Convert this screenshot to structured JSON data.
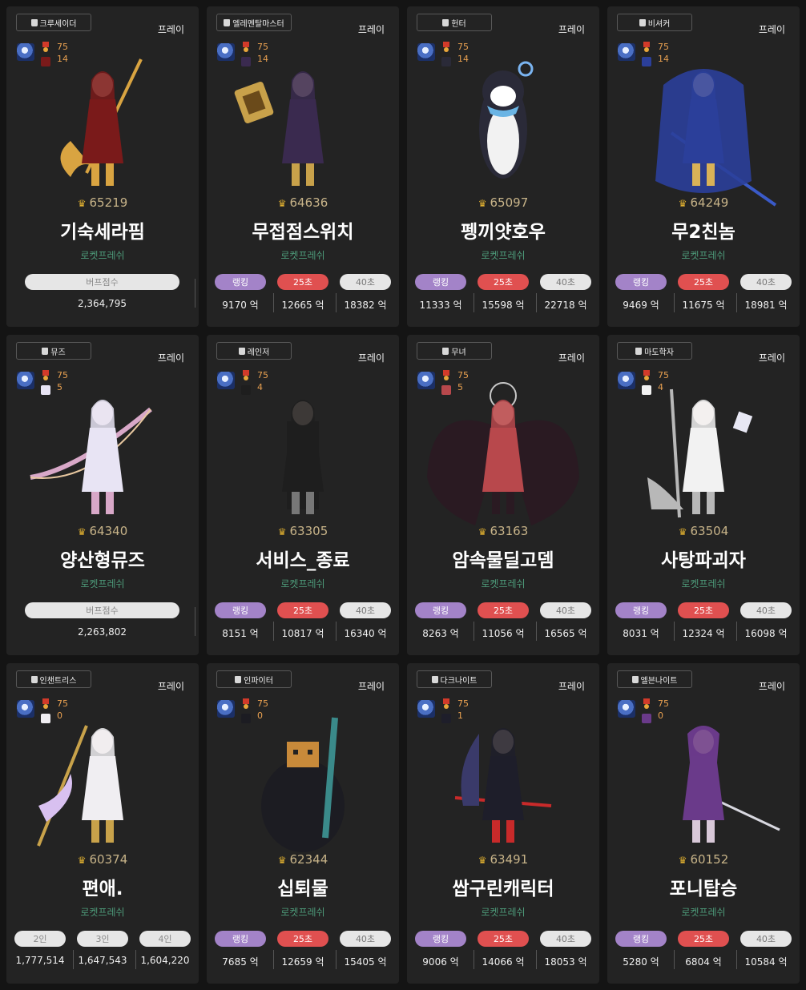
{
  "common": {
    "play_label": "프레이",
    "level": "75"
  },
  "cards": [
    {
      "job": "크루세이더",
      "count": "14",
      "score": "65219",
      "name": "기숙세라핌",
      "guild": "로켓프레쉬",
      "kind": "buff",
      "buff": {
        "label": "버프점수",
        "value": "2,364,795"
      },
      "sprite": {
        "main": "#7a1a1a",
        "accent": "#d9a441",
        "skin": "#f0d6c4",
        "prop": "spear-gold"
      }
    },
    {
      "job": "엘레멘탈마스터",
      "count": "14",
      "score": "64636",
      "name": "무접점스위치",
      "guild": "로켓프레쉬",
      "kind": "dmg",
      "stats": [
        {
          "label": "랭킹",
          "value": "9170 억"
        },
        {
          "label": "25초",
          "value": "12665 억"
        },
        {
          "label": "40초",
          "value": "18382 억"
        }
      ],
      "sprite": {
        "main": "#3a2a4f",
        "accent": "#c8a14a",
        "skin": "#f0d6c4",
        "prop": "book"
      }
    },
    {
      "job": "헌터",
      "count": "14",
      "score": "65097",
      "name": "펭끼얏호우",
      "guild": "로켓프레쉬",
      "kind": "dmg",
      "stats": [
        {
          "label": "랭킹",
          "value": "11333 억"
        },
        {
          "label": "25초",
          "value": "15598 억"
        },
        {
          "label": "40초",
          "value": "22718 억"
        }
      ],
      "sprite": {
        "main": "#2a2a38",
        "accent": "#f2f2f2",
        "skin": "#f6f6f6",
        "prop": "penguin"
      }
    },
    {
      "job": "비셔커",
      "count": "14",
      "score": "64249",
      "name": "무2친놈",
      "guild": "로켓프레쉬",
      "kind": "dmg",
      "stats": [
        {
          "label": "랭킹",
          "value": "9469 억"
        },
        {
          "label": "25초",
          "value": "11675 억"
        },
        {
          "label": "40초",
          "value": "18981 억"
        }
      ],
      "sprite": {
        "main": "#2b3f9a",
        "accent": "#d9b257",
        "skin": "#f0d6c4",
        "prop": "spear-blue"
      }
    },
    {
      "job": "뮤즈",
      "count": "5",
      "score": "64340",
      "name": "양산형뮤즈",
      "guild": "로켓프레쉬",
      "kind": "buff",
      "buff": {
        "label": "버프점수",
        "value": "2,263,802"
      },
      "sprite": {
        "main": "#e8e4f4",
        "accent": "#d8a8c8",
        "skin": "#f6e4dc",
        "prop": "bow"
      }
    },
    {
      "job": "레인저",
      "count": "4",
      "score": "63305",
      "name": "서비스_종료",
      "guild": "로켓프레쉬",
      "kind": "dmg",
      "stats": [
        {
          "label": "랭킹",
          "value": "8151 억"
        },
        {
          "label": "25초",
          "value": "10817 억"
        },
        {
          "label": "40초",
          "value": "16340 억"
        }
      ],
      "sprite": {
        "main": "#1e1e1e",
        "accent": "#777777",
        "skin": "#e8d2c4",
        "prop": "coat"
      }
    },
    {
      "job": "무녀",
      "count": "5",
      "score": "63163",
      "name": "암속물딜고뎀",
      "guild": "로켓프레쉬",
      "kind": "dmg",
      "stats": [
        {
          "label": "랭킹",
          "value": "8263 억"
        },
        {
          "label": "25초",
          "value": "11056 억"
        },
        {
          "label": "40초",
          "value": "16565 억"
        }
      ],
      "sprite": {
        "main": "#b8484c",
        "accent": "#2a1a22",
        "skin": "#f0d6c4",
        "prop": "wings"
      }
    },
    {
      "job": "마도학자",
      "count": "4",
      "score": "63504",
      "name": "사탕파괴자",
      "guild": "로켓프레쉬",
      "kind": "dmg",
      "stats": [
        {
          "label": "랭킹",
          "value": "8031 억"
        },
        {
          "label": "25초",
          "value": "12324 억"
        },
        {
          "label": "40초",
          "value": "16098 억"
        }
      ],
      "sprite": {
        "main": "#f2f2f2",
        "accent": "#b8b8b8",
        "skin": "#f6e4dc",
        "prop": "broom"
      }
    },
    {
      "job": "인챈트리스",
      "count": "0",
      "score": "60374",
      "name": "편애.",
      "guild": "로켓프레쉬",
      "kind": "party",
      "party": [
        {
          "label": "2인",
          "value": "1,777,514"
        },
        {
          "label": "3인",
          "value": "1,647,543"
        },
        {
          "label": "4인",
          "value": "1,604,220"
        }
      ],
      "sprite": {
        "main": "#f0eef2",
        "accent": "#c8a24a",
        "skin": "#f6e4dc",
        "prop": "staff"
      }
    },
    {
      "job": "인파이터",
      "count": "0",
      "score": "62344",
      "name": "십퇴물",
      "guild": "로켓프레쉬",
      "kind": "dmg",
      "stats": [
        {
          "label": "랭킹",
          "value": "7685 억"
        },
        {
          "label": "25초",
          "value": "12659 억"
        },
        {
          "label": "40초",
          "value": "15405 억"
        }
      ],
      "sprite": {
        "main": "#1c1c22",
        "accent": "#c88a3a",
        "skin": "#3a8a8a",
        "prop": "box"
      }
    },
    {
      "job": "다크나이트",
      "count": "1",
      "score": "63491",
      "name": "쌉구린캐릭터",
      "guild": "로켓프레쉬",
      "kind": "dmg",
      "stats": [
        {
          "label": "랭킹",
          "value": "9006 억"
        },
        {
          "label": "25초",
          "value": "14066 억"
        },
        {
          "label": "40초",
          "value": "18053 억"
        }
      ],
      "sprite": {
        "main": "#1e1e2a",
        "accent": "#c82a2a",
        "skin": "#f0d6c4",
        "prop": "sword-red"
      }
    },
    {
      "job": "엘븐나이트",
      "count": "0",
      "score": "60152",
      "name": "포니탑승",
      "guild": "로켓프레쉬",
      "kind": "dmg",
      "stats": [
        {
          "label": "랭킹",
          "value": "5280 억"
        },
        {
          "label": "25초",
          "value": "6804 억"
        },
        {
          "label": "40초",
          "value": "10584 억"
        }
      ],
      "sprite": {
        "main": "#6a3a8a",
        "accent": "#d8c8d8",
        "skin": "#f0d6c4",
        "prop": "sword-silver"
      }
    }
  ]
}
